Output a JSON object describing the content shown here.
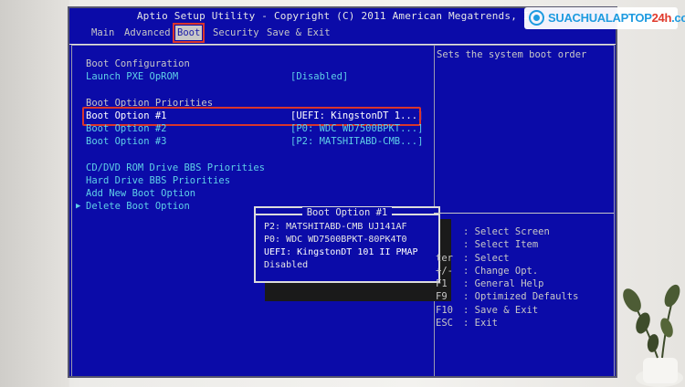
{
  "header": {
    "title": "Aptio Setup Utility - Copyright (C) 2011 American Megatrends, Inc."
  },
  "tabs": [
    {
      "label": "Main",
      "active": false
    },
    {
      "label": "Advanced",
      "active": false
    },
    {
      "label": "Boot",
      "active": true
    },
    {
      "label": "Security",
      "active": false
    },
    {
      "label": "Save & Exit",
      "active": false
    }
  ],
  "boot_config": {
    "heading": "Boot Configuration",
    "pxe_label": "Launch PXE OpROM",
    "pxe_value": "[Disabled]"
  },
  "priorities": {
    "heading": "Boot Option Priorities",
    "options": [
      {
        "label": "Boot Option #1",
        "value": "[UEFI: KingstonDT 1...]"
      },
      {
        "label": "Boot Option #2",
        "value": "[P0: WDC WD7500BPKT...]"
      },
      {
        "label": "Boot Option #3",
        "value": "[P2: MATSHITABD-CMB...]"
      }
    ]
  },
  "more": {
    "cd_bbs": "CD/DVD ROM Drive BBS Priorities",
    "hdd_bbs": "Hard Drive BBS Priorities",
    "add_boot": "Add New Boot Option",
    "delete_boot": "Delete Boot Option"
  },
  "popup": {
    "title": "Boot Option #1",
    "options": [
      {
        "label": "P2: MATSHITABD-CMB UJ141AF",
        "selected": false
      },
      {
        "label": "P0: WDC WD7500BPKT-80PK4T0",
        "selected": false
      },
      {
        "label": "UEFI: KingstonDT 101 II PMAP",
        "selected": true
      },
      {
        "label": "Disabled",
        "selected": false
      }
    ]
  },
  "help": {
    "description": "Sets the system boot order",
    "keys": [
      {
        "key": "",
        "action": ": Select Screen"
      },
      {
        "key": "",
        "action": ": Select Item"
      },
      {
        "key": "ter",
        "action": ": Select"
      },
      {
        "key": "+/-",
        "action": ": Change Opt."
      },
      {
        "key": "F1",
        "action": ": General Help"
      },
      {
        "key": "F9",
        "action": ": Optimized Defaults"
      },
      {
        "key": "F10",
        "action": ": Save & Exit"
      },
      {
        "key": "ESC",
        "action": ": Exit"
      }
    ]
  },
  "watermark": {
    "brand_main": "SUACHUALAPTOP",
    "brand_accent": "24h",
    "brand_tld": ".com"
  },
  "colors": {
    "bios_background": "#0b0ba8",
    "highlight_value": "#5fd0e8",
    "annotation_red": "#d9352c"
  }
}
